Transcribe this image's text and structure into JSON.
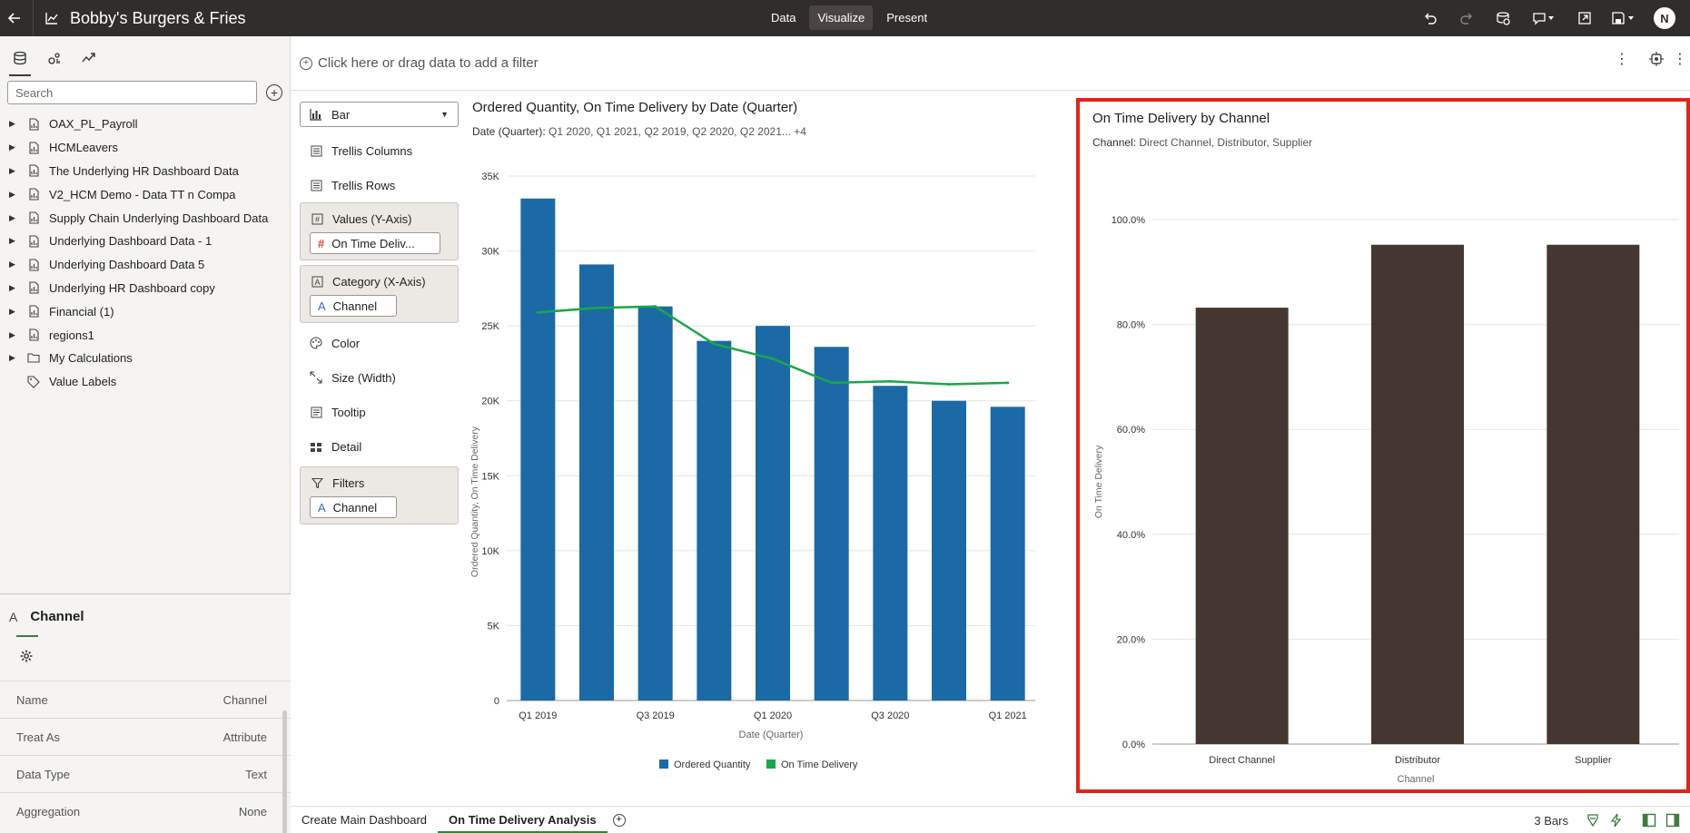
{
  "header": {
    "title": "Bobby's Burgers & Fries",
    "modes": [
      "Data",
      "Visualize",
      "Present"
    ],
    "active_mode": "Visualize",
    "avatar": "N"
  },
  "left_panel": {
    "search_placeholder": "Search",
    "tree": [
      {
        "label": "OAX_PL_Payroll",
        "icon": "dataset-icon",
        "expandable": true
      },
      {
        "label": "HCMLeavers",
        "icon": "dataset-icon",
        "expandable": true
      },
      {
        "label": "The Underlying HR Dashboard Data",
        "icon": "dataset-icon",
        "expandable": true
      },
      {
        "label": "V2_HCM Demo - Data TT n Compa",
        "icon": "dataset-icon",
        "expandable": true
      },
      {
        "label": "Supply Chain Underlying Dashboard Data",
        "icon": "dataset-icon",
        "expandable": true
      },
      {
        "label": "Underlying Dashboard Data - 1",
        "icon": "dataset-icon",
        "expandable": true
      },
      {
        "label": "Underlying Dashboard Data 5",
        "icon": "dataset-icon",
        "expandable": true
      },
      {
        "label": "Underlying HR Dashboard copy",
        "icon": "dataset-icon",
        "expandable": true
      },
      {
        "label": "Financial (1)",
        "icon": "dataset-icon",
        "expandable": true
      },
      {
        "label": "regions1",
        "icon": "dataset-icon",
        "expandable": true
      },
      {
        "label": "My Calculations",
        "icon": "folder-icon",
        "expandable": true
      },
      {
        "label": "Value Labels",
        "icon": "tag-icon",
        "expandable": false
      }
    ],
    "properties": {
      "title": "Channel",
      "rows": [
        {
          "name": "Name",
          "value": "Channel"
        },
        {
          "name": "Treat As",
          "value": "Attribute"
        },
        {
          "name": "Data Type",
          "value": "Text"
        },
        {
          "name": "Aggregation",
          "value": "None"
        }
      ]
    }
  },
  "filter_bar": {
    "text": "Click here or drag data to add a filter"
  },
  "grammar": {
    "chart_type": "Bar",
    "trellis_columns": "Trellis Columns",
    "trellis_rows": "Trellis Rows",
    "values_label": "Values (Y-Axis)",
    "values_pill": "On Time Deliv...",
    "category_label": "Category (X-Axis)",
    "category_pill": "Channel",
    "color": "Color",
    "size": "Size (Width)",
    "tooltip": "Tooltip",
    "detail": "Detail",
    "filters_label": "Filters",
    "filters_pill": "Channel"
  },
  "chart1": {
    "title": "Ordered Quantity, On Time Delivery by Date (Quarter)",
    "subtitle_label": "Date (Quarter):",
    "subtitle_values": "Q1 2020, Q1 2021, Q2 2019, Q2 2020, Q2 2021... +4",
    "legend": [
      "Ordered Quantity",
      "On Time Delivery"
    ]
  },
  "chart2": {
    "title": "On Time Delivery by Channel",
    "subtitle_label": "Channel:",
    "subtitle_values": "Direct Channel, Distributor, Supplier"
  },
  "chart_data": [
    {
      "type": "bar",
      "title": "Ordered Quantity, On Time Delivery by Date (Quarter)",
      "xlabel": "Date (Quarter)",
      "ylabel": "Ordered Quantity, On Time Delivery",
      "categories": [
        "Q1 2019",
        "",
        "Q3 2019",
        "",
        "Q1 2020",
        "",
        "Q3 2020",
        "",
        "Q1 2021",
        ""
      ],
      "ylim": [
        0,
        35000
      ],
      "yticks": [
        "0",
        "5K",
        "10K",
        "15K",
        "20K",
        "25K",
        "30K",
        "35K"
      ],
      "series": [
        {
          "name": "Ordered Quantity",
          "type": "bar",
          "color": "#1b6aa5",
          "values": [
            33500,
            29100,
            26300,
            24000,
            25000,
            23600,
            21000,
            20000,
            19600
          ]
        },
        {
          "name": "On Time Delivery",
          "type": "line",
          "color": "#1aa74a",
          "values": [
            25900,
            26200,
            26300,
            23800,
            22800,
            21200,
            21300,
            21100,
            21200
          ]
        }
      ]
    },
    {
      "type": "bar",
      "title": "On Time Delivery by Channel",
      "xlabel": "Channel",
      "ylabel": "On Time Delivery",
      "categories": [
        "Direct Channel",
        "Distributor",
        "Supplier"
      ],
      "ylim": [
        0,
        100
      ],
      "yticks": [
        "0.0%",
        "20.0%",
        "40.0%",
        "60.0%",
        "80.0%",
        "100.0%"
      ],
      "series": [
        {
          "name": "On Time Delivery",
          "color": "#443631",
          "values": [
            83.2,
            95.2,
            95.2
          ]
        }
      ]
    }
  ],
  "bottom_bar": {
    "tabs": [
      "Create Main Dashboard",
      "On Time Delivery Analysis"
    ],
    "active_tab": "On Time Delivery Analysis",
    "status": "3 Bars"
  }
}
